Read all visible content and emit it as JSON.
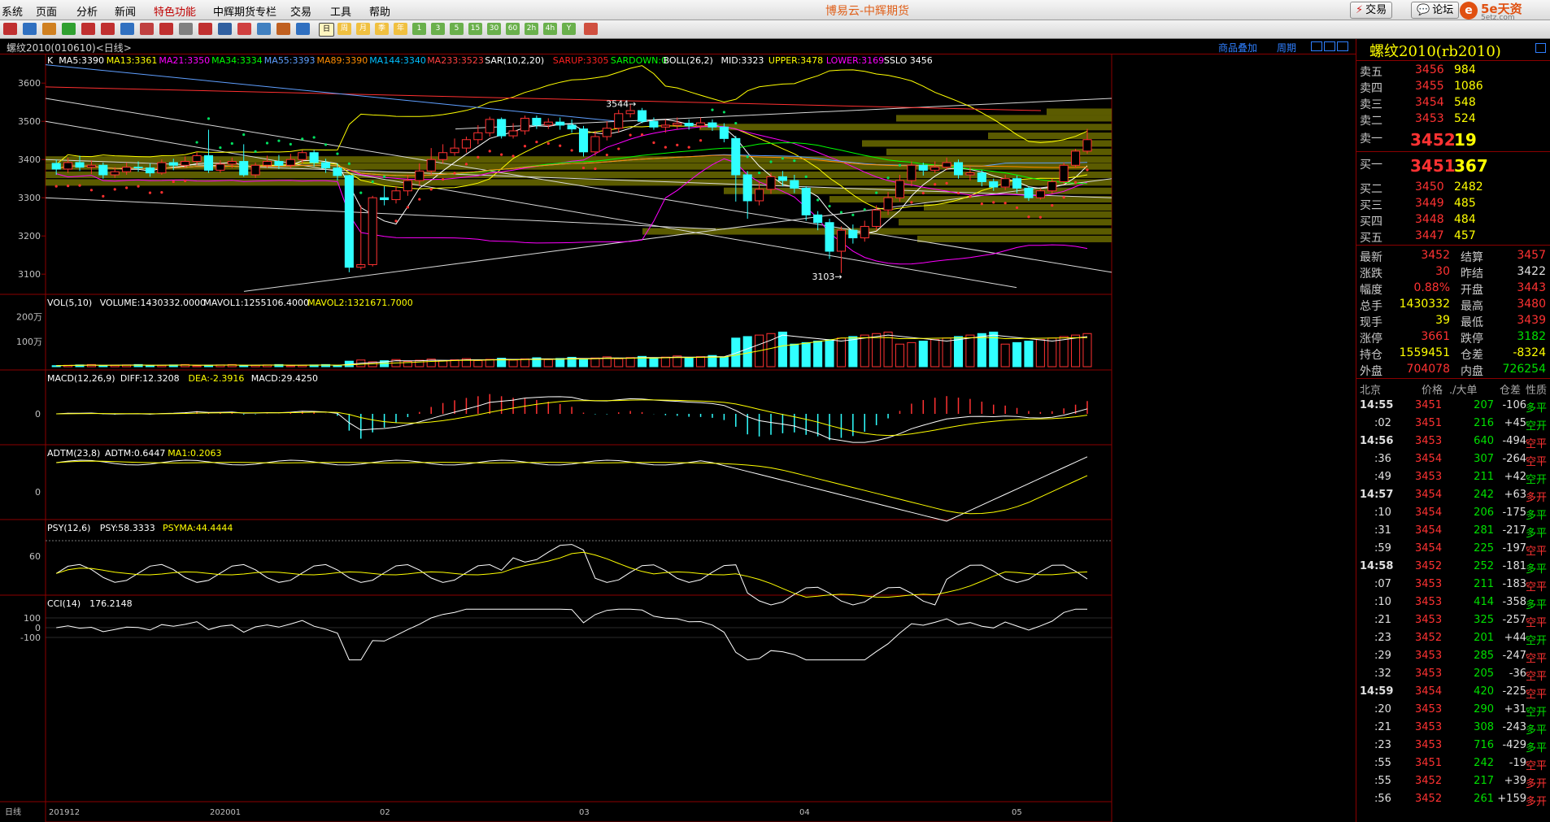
{
  "menu": {
    "items": [
      "系统",
      "页面",
      "分析",
      "新闻",
      "特色功能",
      "中辉期货专栏",
      "交易",
      "工具",
      "帮助"
    ],
    "app_title": "博易云-中辉期货",
    "trade_btn": "交易",
    "forum_btn": "论坛",
    "brand": "5e天资",
    "brand_sub": "5etz.com"
  },
  "toolbar": {
    "period_buttons": [
      "日",
      "周",
      "月",
      "季",
      "年",
      "1",
      "3",
      "5",
      "15",
      "30",
      "60",
      "2h",
      "4h",
      "Y"
    ]
  },
  "chart_head": {
    "symbol": "螺纹2010(010610)<日线>",
    "overlay_link": "商品叠加",
    "period_link": "周期"
  },
  "indicators": {
    "main": [
      {
        "text": "K",
        "color": "#ffffff"
      },
      {
        "text": "MA5:3390",
        "color": "#ffffff"
      },
      {
        "text": "MA13:3361",
        "color": "#ffff00"
      },
      {
        "text": "MA21:3350",
        "color": "#ff00ff"
      },
      {
        "text": "MA34:3334",
        "color": "#00ff00"
      },
      {
        "text": "MA55:3393",
        "color": "#5f9fff"
      },
      {
        "text": "MA89:3390",
        "color": "#ff8c00"
      },
      {
        "text": "MA144:3340",
        "color": "#00bfff"
      },
      {
        "text": "MA233:3523",
        "color": "#ff4040"
      },
      {
        "text": "SAR(10,2,20)",
        "color": "#ffffff"
      },
      {
        "text": "SARUP:3305",
        "color": "#ff2020"
      },
      {
        "text": "SARDOWN:0",
        "color": "#00ff00"
      },
      {
        "text": "BOLL(26,2)",
        "color": "#ffffff"
      },
      {
        "text": "MID:3323",
        "color": "#ffffff"
      },
      {
        "text": "UPPER:3478",
        "color": "#ffff00"
      },
      {
        "text": "LOWER:3169",
        "color": "#ff00ff"
      },
      {
        "text": "SSLO 3456",
        "color": "#ffffff"
      }
    ],
    "vol": [
      {
        "text": "VOL(5,10)",
        "color": "#ffffff"
      },
      {
        "text": "VOLUME:1430332.0000",
        "color": "#ffffff"
      },
      {
        "text": "MAVOL1:1255106.4000",
        "color": "#ffffff"
      },
      {
        "text": "MAVOL2:1321671.7000",
        "color": "#ffff00"
      }
    ],
    "macd": [
      {
        "text": "MACD(12,26,9)",
        "color": "#ffffff"
      },
      {
        "text": "DIFF:12.3208",
        "color": "#ffffff"
      },
      {
        "text": "DEA:-2.3916",
        "color": "#ffff00"
      },
      {
        "text": "MACD:29.4250",
        "color": "#ffffff"
      }
    ],
    "adtm": [
      {
        "text": "ADTM(23,8)",
        "color": "#ffffff"
      },
      {
        "text": "ADTM:0.6447",
        "color": "#ffffff"
      },
      {
        "text": "MA1:0.2063",
        "color": "#ffff00"
      }
    ],
    "psy": [
      {
        "text": "PSY(12,6)",
        "color": "#ffffff"
      },
      {
        "text": "PSY:58.3333",
        "color": "#ffffff"
      },
      {
        "text": "PSYMA:44.4444",
        "color": "#ffff00"
      }
    ],
    "cci": [
      {
        "text": "CCI(14)",
        "color": "#ffffff"
      },
      {
        "text": "176.2148",
        "color": "#ffffff"
      }
    ]
  },
  "axes": {
    "price_ticks": [
      "3600",
      "3500",
      "3400",
      "3300",
      "3200",
      "3100"
    ],
    "vol_ticks": [
      "200万",
      "100万"
    ],
    "macd_ticks": [
      "0"
    ],
    "adtm_ticks": [
      "0"
    ],
    "psy_ticks": [
      "60"
    ],
    "cci_ticks": [
      "100",
      "0",
      "-100"
    ],
    "date_labels": [
      "日线",
      "201912",
      "202001",
      "02",
      "03",
      "04",
      "05"
    ],
    "hi_label": "3544",
    "lo_label": "3103"
  },
  "chart_data": {
    "type": "candlestick",
    "ylim": [
      3060,
      3660
    ],
    "high_marker": 3544,
    "low_marker": 3103,
    "bars": [
      [
        3390,
        3375,
        3400,
        3360
      ],
      [
        3375,
        3392,
        3405,
        3365
      ],
      [
        3392,
        3380,
        3410,
        3370
      ],
      [
        3380,
        3385,
        3398,
        3362
      ],
      [
        3385,
        3360,
        3392,
        3350
      ],
      [
        3360,
        3368,
        3380,
        3352
      ],
      [
        3368,
        3380,
        3392,
        3360
      ],
      [
        3380,
        3378,
        3395,
        3368
      ],
      [
        3378,
        3365,
        3390,
        3355
      ],
      [
        3365,
        3392,
        3400,
        3360
      ],
      [
        3392,
        3385,
        3402,
        3372
      ],
      [
        3385,
        3395,
        3408,
        3378
      ],
      [
        3395,
        3410,
        3420,
        3385
      ],
      [
        3410,
        3372,
        3478,
        3365
      ],
      [
        3372,
        3388,
        3398,
        3365
      ],
      [
        3388,
        3395,
        3405,
        3378
      ],
      [
        3395,
        3360,
        3440,
        3355
      ],
      [
        3360,
        3385,
        3392,
        3352
      ],
      [
        3385,
        3395,
        3410,
        3378
      ],
      [
        3395,
        3385,
        3412,
        3375
      ],
      [
        3385,
        3400,
        3415,
        3378
      ],
      [
        3400,
        3418,
        3425,
        3390
      ],
      [
        3418,
        3392,
        3425,
        3382
      ],
      [
        3392,
        3378,
        3402,
        3365
      ],
      [
        3378,
        3358,
        3390,
        3345
      ],
      [
        3358,
        3118,
        3360,
        3105
      ],
      [
        3118,
        3125,
        3280,
        3112
      ],
      [
        3125,
        3300,
        3305,
        3120
      ],
      [
        3300,
        3295,
        3330,
        3280
      ],
      [
        3295,
        3318,
        3330,
        3285
      ],
      [
        3318,
        3345,
        3360,
        3305
      ],
      [
        3345,
        3370,
        3390,
        3330
      ],
      [
        3370,
        3400,
        3430,
        3360
      ],
      [
        3400,
        3418,
        3440,
        3390
      ],
      [
        3418,
        3430,
        3455,
        3410
      ],
      [
        3430,
        3452,
        3460,
        3418
      ],
      [
        3452,
        3470,
        3490,
        3440
      ],
      [
        3470,
        3505,
        3512,
        3460
      ],
      [
        3505,
        3462,
        3510,
        3455
      ],
      [
        3462,
        3475,
        3495,
        3455
      ],
      [
        3475,
        3508,
        3515,
        3465
      ],
      [
        3508,
        3490,
        3515,
        3480
      ],
      [
        3490,
        3498,
        3508,
        3480
      ],
      [
        3498,
        3490,
        3510,
        3478
      ],
      [
        3490,
        3480,
        3505,
        3470
      ],
      [
        3480,
        3420,
        3488,
        3408
      ],
      [
        3420,
        3460,
        3475,
        3410
      ],
      [
        3460,
        3482,
        3500,
        3450
      ],
      [
        3482,
        3520,
        3530,
        3470
      ],
      [
        3520,
        3528,
        3544,
        3510
      ],
      [
        3528,
        3500,
        3535,
        3495
      ],
      [
        3500,
        3485,
        3510,
        3478
      ],
      [
        3485,
        3490,
        3505,
        3470
      ],
      [
        3490,
        3495,
        3510,
        3480
      ],
      [
        3495,
        3488,
        3505,
        3478
      ],
      [
        3488,
        3496,
        3510,
        3480
      ],
      [
        3496,
        3485,
        3505,
        3475
      ],
      [
        3485,
        3455,
        3495,
        3445
      ],
      [
        3455,
        3360,
        3462,
        3290
      ],
      [
        3360,
        3292,
        3370,
        3245
      ],
      [
        3292,
        3322,
        3340,
        3280
      ],
      [
        3322,
        3355,
        3365,
        3310
      ],
      [
        3355,
        3345,
        3370,
        3330
      ],
      [
        3345,
        3325,
        3360,
        3312
      ],
      [
        3325,
        3255,
        3330,
        3240
      ],
      [
        3255,
        3235,
        3265,
        3215
      ],
      [
        3235,
        3160,
        3245,
        3140
      ],
      [
        3160,
        3215,
        3225,
        3103
      ],
      [
        3215,
        3195,
        3230,
        3180
      ],
      [
        3195,
        3225,
        3240,
        3185
      ],
      [
        3225,
        3268,
        3280,
        3215
      ],
      [
        3268,
        3300,
        3315,
        3255
      ],
      [
        3300,
        3345,
        3360,
        3290
      ],
      [
        3345,
        3385,
        3395,
        3330
      ],
      [
        3385,
        3372,
        3392,
        3358
      ],
      [
        3372,
        3380,
        3395,
        3365
      ],
      [
        3380,
        3392,
        3405,
        3372
      ],
      [
        3392,
        3360,
        3400,
        3350
      ],
      [
        3360,
        3365,
        3380,
        3345
      ],
      [
        3365,
        3342,
        3372,
        3330
      ],
      [
        3342,
        3328,
        3350,
        3318
      ],
      [
        3328,
        3350,
        3360,
        3320
      ],
      [
        3350,
        3325,
        3358,
        3312
      ],
      [
        3325,
        3300,
        3330,
        3292
      ],
      [
        3300,
        3318,
        3325,
        3295
      ],
      [
        3318,
        3342,
        3350,
        3310
      ],
      [
        3342,
        3385,
        3392,
        3335
      ],
      [
        3385,
        3422,
        3428,
        3378
      ],
      [
        3422,
        3452,
        3480,
        3415
      ]
    ]
  },
  "quote": {
    "title": "螺纹2010(rb2010)",
    "asks": [
      {
        "label": "卖五",
        "price": "3456",
        "vol": "984"
      },
      {
        "label": "卖四",
        "price": "3455",
        "vol": "1086"
      },
      {
        "label": "卖三",
        "price": "3454",
        "vol": "548"
      },
      {
        "label": "卖二",
        "price": "3453",
        "vol": "524"
      }
    ],
    "ask1": {
      "label": "卖一",
      "price": "3452",
      "vol": "19"
    },
    "bid1": {
      "label": "买一",
      "price": "3451",
      "vol": "367"
    },
    "bids": [
      {
        "label": "买二",
        "price": "3450",
        "vol": "2482"
      },
      {
        "label": "买三",
        "price": "3449",
        "vol": "485"
      },
      {
        "label": "买四",
        "price": "3448",
        "vol": "484"
      },
      {
        "label": "买五",
        "price": "3447",
        "vol": "457"
      }
    ],
    "stats": [
      {
        "l1": "最新",
        "v1": "3452",
        "c1": "red",
        "l2": "结算",
        "v2": "3457",
        "c2": "red"
      },
      {
        "l1": "涨跌",
        "v1": "30",
        "c1": "red",
        "l2": "昨结",
        "v2": "3422",
        "c2": "white"
      },
      {
        "l1": "幅度",
        "v1": "0.88%",
        "c1": "red",
        "l2": "开盘",
        "v2": "3443",
        "c2": "red"
      },
      {
        "l1": "总手",
        "v1": "1430332",
        "c1": "yellow",
        "l2": "最高",
        "v2": "3480",
        "c2": "red"
      },
      {
        "l1": "现手",
        "v1": "39",
        "c1": "yellow",
        "l2": "最低",
        "v2": "3439",
        "c2": "red"
      },
      {
        "l1": "涨停",
        "v1": "3661",
        "c1": "red",
        "l2": "跌停",
        "v2": "3182",
        "c2": "green"
      },
      {
        "l1": "持仓",
        "v1": "1559451",
        "c1": "yellow",
        "l2": "仓差",
        "v2": "-8324",
        "c2": "yellow"
      },
      {
        "l1": "外盘",
        "v1": "704078",
        "c1": "red",
        "l2": "内盘",
        "v2": "726254",
        "c2": "green"
      }
    ],
    "tick_head": {
      "time": "北京",
      "price": "价格",
      "vol": "./大单",
      "oi": "仓差",
      "type": "性质"
    },
    "ticks": [
      {
        "t": "14:55",
        "p": "3451",
        "pc": "red",
        "v": "207",
        "oi": "-106",
        "ty": "多平",
        "tc": "green"
      },
      {
        "t": ":02",
        "p": "3451",
        "pc": "red",
        "v": "216",
        "oi": "+45",
        "ty": "空开",
        "tc": "green"
      },
      {
        "t": "14:56",
        "p": "3453",
        "pc": "red",
        "v": "640",
        "oi": "-494",
        "ty": "空平",
        "tc": "red"
      },
      {
        "t": ":36",
        "p": "3454",
        "pc": "red",
        "v": "307",
        "oi": "-264",
        "ty": "空平",
        "tc": "red"
      },
      {
        "t": ":49",
        "p": "3453",
        "pc": "red",
        "v": "211",
        "oi": "+42",
        "ty": "空开",
        "tc": "green"
      },
      {
        "t": "14:57",
        "p": "3454",
        "pc": "red",
        "v": "242",
        "oi": "+63",
        "ty": "多开",
        "tc": "red"
      },
      {
        "t": ":10",
        "p": "3454",
        "pc": "red",
        "v": "206",
        "oi": "-175",
        "ty": "多平",
        "tc": "green"
      },
      {
        "t": ":31",
        "p": "3454",
        "pc": "red",
        "v": "281",
        "oi": "-217",
        "ty": "多平",
        "tc": "green"
      },
      {
        "t": ":59",
        "p": "3454",
        "pc": "red",
        "v": "225",
        "oi": "-197",
        "ty": "空平",
        "tc": "red"
      },
      {
        "t": "14:58",
        "p": "3452",
        "pc": "red",
        "v": "252",
        "oi": "-181",
        "ty": "多平",
        "tc": "green"
      },
      {
        "t": ":07",
        "p": "3453",
        "pc": "red",
        "v": "211",
        "oi": "-183",
        "ty": "空平",
        "tc": "red"
      },
      {
        "t": ":10",
        "p": "3453",
        "pc": "red",
        "v": "414",
        "oi": "-358",
        "ty": "多平",
        "tc": "green"
      },
      {
        "t": ":21",
        "p": "3453",
        "pc": "red",
        "v": "325",
        "oi": "-257",
        "ty": "空平",
        "tc": "red"
      },
      {
        "t": ":23",
        "p": "3452",
        "pc": "red",
        "v": "201",
        "oi": "+44",
        "ty": "空开",
        "tc": "green"
      },
      {
        "t": ":29",
        "p": "3453",
        "pc": "red",
        "v": "285",
        "oi": "-247",
        "ty": "空平",
        "tc": "red"
      },
      {
        "t": ":32",
        "p": "3453",
        "pc": "red",
        "v": "205",
        "oi": "-36",
        "ty": "空平",
        "tc": "red"
      },
      {
        "t": "14:59",
        "p": "3454",
        "pc": "red",
        "v": "420",
        "oi": "-225",
        "ty": "空平",
        "tc": "red"
      },
      {
        "t": ":20",
        "p": "3453",
        "pc": "red",
        "v": "290",
        "oi": "+31",
        "ty": "空开",
        "tc": "green"
      },
      {
        "t": ":21",
        "p": "3453",
        "pc": "red",
        "v": "308",
        "oi": "-243",
        "ty": "多平",
        "tc": "green"
      },
      {
        "t": ":23",
        "p": "3453",
        "pc": "red",
        "v": "716",
        "oi": "-429",
        "ty": "多平",
        "tc": "green"
      },
      {
        "t": ":55",
        "p": "3451",
        "pc": "red",
        "v": "242",
        "oi": "-19",
        "ty": "空平",
        "tc": "red"
      },
      {
        "t": ":55",
        "p": "3452",
        "pc": "red",
        "v": "217",
        "oi": "+39",
        "ty": "多开",
        "tc": "red"
      },
      {
        "t": ":56",
        "p": "3452",
        "pc": "red",
        "v": "261",
        "oi": "+159",
        "ty": "多开",
        "tc": "red"
      }
    ]
  }
}
